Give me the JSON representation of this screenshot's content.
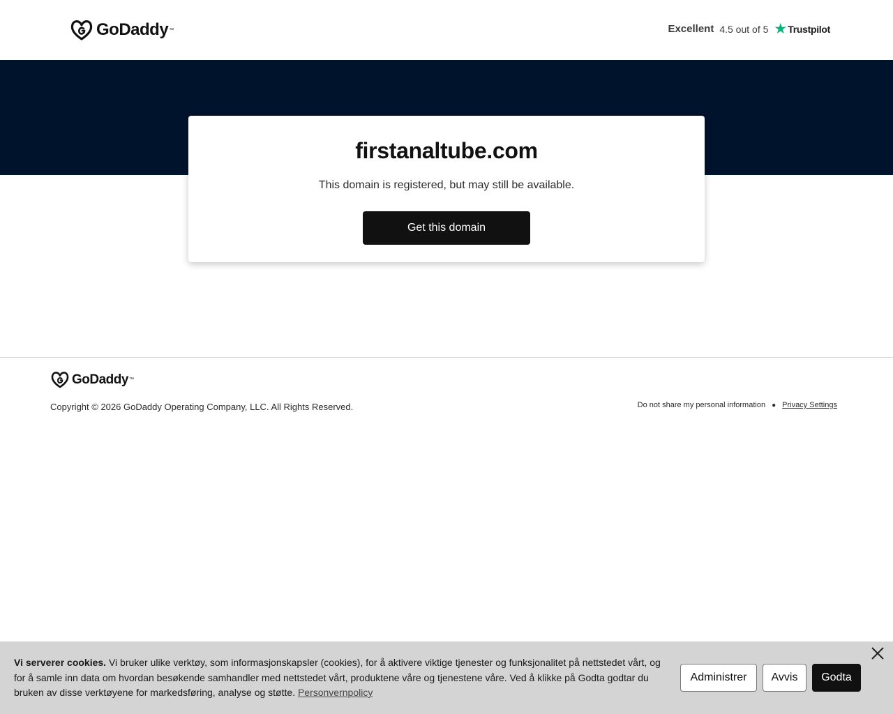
{
  "header": {
    "brand": "GoDaddy",
    "trustpilot": {
      "rating_word": "Excellent",
      "score_text": "4.5 out of 5",
      "brand": "Trustpilot"
    }
  },
  "main": {
    "domain": "firstanaltube.com",
    "subtitle": "This domain is registered, but may still be available.",
    "cta_label": "Get this domain"
  },
  "footer": {
    "brand": "GoDaddy",
    "copyright": "Copyright © 2026 GoDaddy Operating Company, LLC. All Rights Reserved.",
    "links": {
      "do_not_share": "Do not share my personal information",
      "privacy_settings": "Privacy Settings"
    }
  },
  "cookie_banner": {
    "heading": "Vi serverer cookies.",
    "body": "Vi bruker ulike verktøy, som informasjonskapsler (cookies), for å aktivere viktige tjenester og funksjonalitet på nettstedet vårt, og for å samle inn data om hvordan besøkende samhandler med nettstedet vårt, produktene våre og tjenestene våre. Ved å klikke på Godta godtar du bruken av disse verktøyene for markedsføring, analyse og støtte.",
    "policy_link": "Personvernpolicy",
    "buttons": {
      "manage": "Administrer",
      "reject": "Avvis",
      "accept": "Godta"
    }
  },
  "colors": {
    "hero_bg": "#00132c",
    "trustpilot_star": "#00b67a",
    "button_dark": "#111111",
    "cookie_bg": "#d4d4d4"
  },
  "icons": {
    "logo": "godaddy-logo-icon",
    "trust_star": "star-icon",
    "close": "close-icon"
  }
}
